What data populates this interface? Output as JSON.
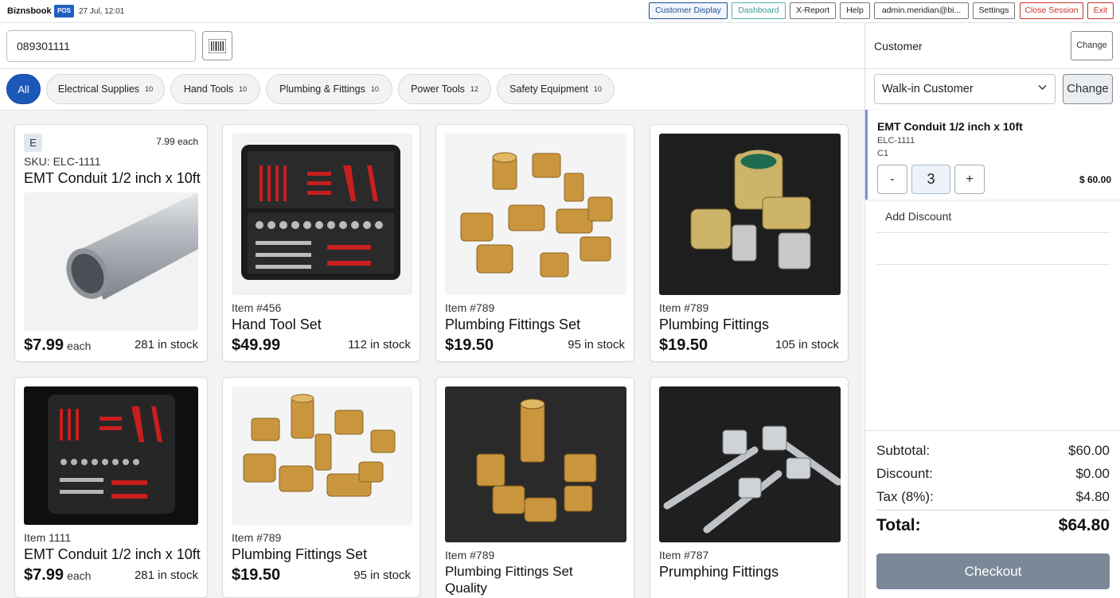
{
  "app": {
    "brand": "Biznsbook",
    "badge": "POS",
    "datetime": "27 Jul, 12:01"
  },
  "toolbar": {
    "customer_display": "Customer Display",
    "dashboard": "Dashboard",
    "x_report": "X-Report",
    "help": "Help",
    "user": "admin.meridian@bi...",
    "settings": "Settings",
    "close_session": "Close Session",
    "exit": "Exit"
  },
  "search": {
    "value": "089301111"
  },
  "categories": [
    {
      "label": "All",
      "count": ""
    },
    {
      "label": "Electrical Supplies",
      "count": "10"
    },
    {
      "label": "Hand Tools",
      "count": "10"
    },
    {
      "label": "Plumbing & Fittings",
      "count": "10"
    },
    {
      "label": "Power Tools",
      "count": "12"
    },
    {
      "label": "Safety Equipment",
      "count": "10"
    }
  ],
  "products": [
    {
      "badge": "E",
      "each_price": "7.99 each",
      "sku": "SKU: ELC-1111",
      "name": "EMT Conduit 1/2 inch x 10ft",
      "price": "$7.99",
      "unit": "each",
      "stock": "281 in stock",
      "image": "conduit-pipe"
    },
    {
      "item": "Item #456",
      "name": "Hand Tool Set",
      "price": "$49.99",
      "stock": "112 in stock",
      "image": "tool-case"
    },
    {
      "item": "Item #789",
      "name": "Plumbing Fittings Set",
      "price": "$19.50",
      "stock": "95 in stock",
      "image": "brass-fittings"
    },
    {
      "item": "Item #789",
      "name": "Plumbing Fittings",
      "price": "$19.50",
      "stock": "105 in stock",
      "image": "brass-valve"
    },
    {
      "item": "Item 1111",
      "name": "EMT Conduit 1/2 inch x 10ft",
      "price": "$7.99",
      "unit": "each",
      "stock": "281 in stock",
      "image": "tool-case"
    },
    {
      "item": "Item #789",
      "name": "Plumbing Fittings Set",
      "price": "$19.50",
      "stock": "95 in stock",
      "image": "brass-fittings"
    },
    {
      "item": "Item #789",
      "name": "Plumbing Fittings Set",
      "name2": "Quality",
      "image": "brass-fittings-dark"
    },
    {
      "item": "Item #787",
      "name": "Prumphing Fittings",
      "image": "steel-pipes"
    }
  ],
  "cart": {
    "customer_label": "Customer",
    "change_small": "Change",
    "selected_customer": "Walk-in Customer",
    "change": "Change",
    "item": {
      "name": "EMT Conduit 1/2 inch x 10ft",
      "sku": "ELC-1111",
      "code": "C1",
      "minus": "-",
      "qty": "3",
      "plus": "+",
      "price": "$ 60.00"
    },
    "add_discount": "Add Discount",
    "summary": {
      "subtotal_label": "Subtotal:",
      "subtotal": "$60.00",
      "discount_label": "Discount:",
      "discount": "$0.00",
      "tax_label": "Tax (8%):",
      "tax": "$4.80",
      "total_label": "Total:",
      "total": "$64.80"
    },
    "checkout": "Checkout"
  },
  "colors": {
    "primary": "#1c58b8",
    "checkout": "#7a8898",
    "danger": "#c9302c",
    "teal": "#4fb2ae"
  }
}
